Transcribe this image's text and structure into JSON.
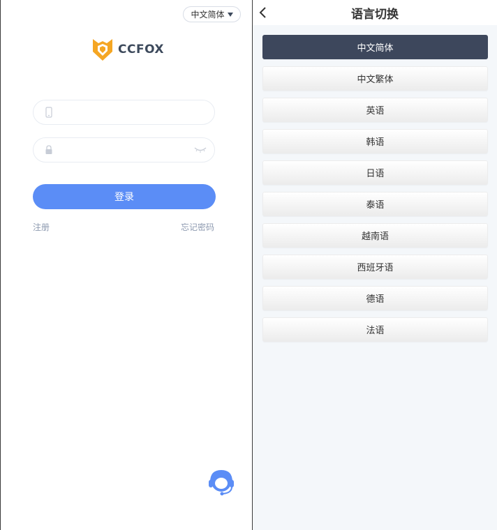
{
  "login": {
    "language_selector": "中文简体",
    "logo_text": "CCFOX",
    "phone_input": {
      "value": "",
      "placeholder": ""
    },
    "password_input": {
      "value": "",
      "placeholder": ""
    },
    "login_button": "登录",
    "register_link": "注册",
    "forgot_link": "忘记密码"
  },
  "language_page": {
    "title": "语言切换",
    "selected": "中文简体",
    "languages": [
      {
        "label": "中文简体",
        "active": true
      },
      {
        "label": "中文繁体",
        "active": false
      },
      {
        "label": "英语",
        "active": false
      },
      {
        "label": "韩语",
        "active": false
      },
      {
        "label": "日语",
        "active": false
      },
      {
        "label": "泰语",
        "active": false
      },
      {
        "label": "越南语",
        "active": false
      },
      {
        "label": "西班牙语",
        "active": false
      },
      {
        "label": "德语",
        "active": false
      },
      {
        "label": "法语",
        "active": false
      }
    ]
  },
  "colors": {
    "primary_button": "#5b8df6",
    "active_language": "#3d475c",
    "logo_orange": "#f5a623",
    "link_gray": "#8e9ab0"
  },
  "icons": {
    "phone": "phone-icon",
    "lock": "lock-icon",
    "eye": "eye-closed-icon",
    "back": "chevron-left-icon",
    "support": "customer-service-icon",
    "caret": "caret-down-icon"
  }
}
